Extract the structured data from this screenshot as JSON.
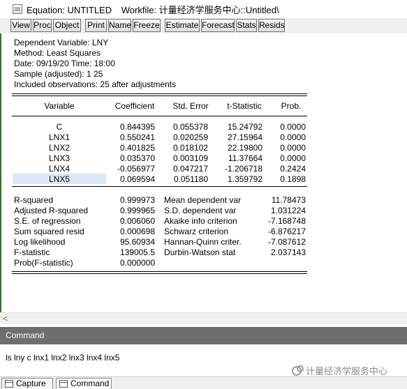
{
  "window": {
    "title": "Equation: UNTITLED",
    "workfile": "Workfile: 计量经济学服务中心::Untitled\\"
  },
  "toolbar": {
    "buttons": [
      "View",
      "Proc",
      "Object",
      "Print",
      "Name",
      "Freeze",
      "Estimate",
      "Forecast",
      "Stats",
      "Resids"
    ]
  },
  "output": {
    "header": [
      "Dependent Variable: LNY",
      "Method: Least Squares",
      "Date: 09/19/20   Time: 18:00",
      "Sample (adjusted): 1 25",
      "Included observations: 25 after adjustments"
    ],
    "columns": [
      "Variable",
      "Coefficient",
      "Std. Error",
      "t-Statistic",
      "Prob."
    ],
    "rows": [
      {
        "variable": "C",
        "coef": "0.844395",
        "se": "0.055378",
        "t": "15.24792",
        "prob": "0.0000"
      },
      {
        "variable": "LNX1",
        "coef": "0.550241",
        "se": "0.020259",
        "t": "27.15964",
        "prob": "0.0000"
      },
      {
        "variable": "LNX2",
        "coef": "0.401825",
        "se": "0.018102",
        "t": "22.19800",
        "prob": "0.0000"
      },
      {
        "variable": "LNX3",
        "coef": "0.035370",
        "se": "0.003109",
        "t": "11.37664",
        "prob": "0.0000"
      },
      {
        "variable": "LNX4",
        "coef": "-0.056977",
        "se": "0.047217",
        "t": "-1.206718",
        "prob": "0.2424"
      },
      {
        "variable": "LNX5",
        "coef": "0.069594",
        "se": "0.051180",
        "t": "1.359792",
        "prob": "0.1898"
      }
    ],
    "stats_left": [
      {
        "label": "R-squared",
        "value": "0.999973"
      },
      {
        "label": "Adjusted R-squared",
        "value": "0.999965"
      },
      {
        "label": "S.E. of regression",
        "value": "0.006060"
      },
      {
        "label": "Sum squared resid",
        "value": "0.000698"
      },
      {
        "label": "Log likelihood",
        "value": "95.60934"
      },
      {
        "label": "F-statistic",
        "value": "139005.5"
      },
      {
        "label": "Prob(F-statistic)",
        "value": "0.000000"
      }
    ],
    "stats_right": [
      {
        "label": "Mean dependent var",
        "value": "11.78473"
      },
      {
        "label": "S.D. dependent var",
        "value": "1.031224"
      },
      {
        "label": "Akaike info criterion",
        "value": "-7.168748"
      },
      {
        "label": "Schwarz criterion",
        "value": "-6.876217"
      },
      {
        "label": "Hannan-Quinn criter.",
        "value": "-7.087612"
      },
      {
        "label": "Durbin-Watson stat",
        "value": "2.037143"
      }
    ]
  },
  "scrollbar": {
    "left_arrow": "<"
  },
  "command": {
    "header": "Command",
    "text": "ls lny c lnx1 lnx2 lnx3 lnx4 lnx5"
  },
  "watermark": "计量经济学服务中心",
  "tabs": [
    {
      "label": "Capture"
    },
    {
      "label": "Command"
    }
  ],
  "colors": {
    "selected_row": "#dde8f7",
    "command_header": "#6e6e6e"
  }
}
